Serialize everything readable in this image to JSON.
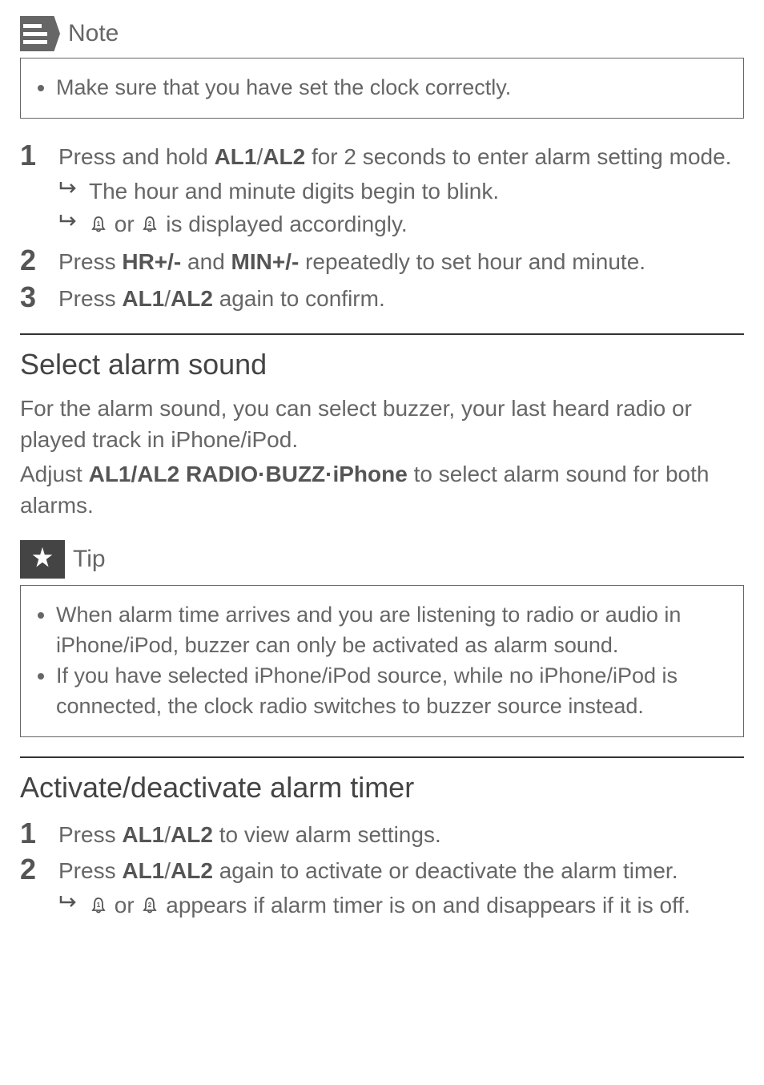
{
  "note": {
    "label": "Note",
    "items": [
      "Make sure that you have set the clock correctly."
    ]
  },
  "alarm_set_steps": [
    {
      "num": "1",
      "parts": [
        "Press and hold ",
        "AL1",
        "/",
        "AL2",
        " for 2 seconds to enter alarm setting mode."
      ],
      "results": [
        {
          "text_before": "The hour and minute digits begin to blink.",
          "text_mid": "",
          "text_after": ""
        },
        {
          "text_before": "",
          "text_mid": " or ",
          "text_after": " is displayed accordingly.",
          "icons": true
        }
      ]
    },
    {
      "num": "2",
      "parts": [
        "Press ",
        "HR+/-",
        " and ",
        "MIN+/-",
        " repeatedly to set hour and minute."
      ]
    },
    {
      "num": "3",
      "parts": [
        "Press ",
        "AL1",
        "/",
        "AL2",
        " again to confirm."
      ]
    }
  ],
  "select_sound": {
    "title": "Select alarm sound",
    "p1": "For the alarm sound, you can select buzzer, your last heard radio or played track in iPhone/iPod.",
    "p2_parts": [
      "Adjust ",
      "AL1/AL2 RADIO·BUZZ·iPhone",
      "  to select alarm sound for both alarms."
    ]
  },
  "tip": {
    "label": "Tip",
    "items": [
      "When alarm time arrives and you are listening to radio or audio in iPhone/iPod, buzzer can only be activated as alarm sound.",
      "If you have selected iPhone/iPod source, while no iPhone/iPod is connected, the clock radio switches to buzzer source instead."
    ]
  },
  "activate": {
    "title": "Activate/deactivate alarm timer",
    "steps": [
      {
        "num": "1",
        "parts": [
          "Press ",
          "AL1",
          "/",
          "AL2",
          " to view alarm settings."
        ]
      },
      {
        "num": "2",
        "parts": [
          "Press ",
          "AL1",
          "/",
          "AL2",
          " again to activate or deactivate the alarm timer."
        ],
        "result": {
          "text_before": "",
          "text_mid": " or ",
          "text_after": " appears if alarm timer is on and disappears if it is off.",
          "icons": true
        }
      }
    ]
  }
}
